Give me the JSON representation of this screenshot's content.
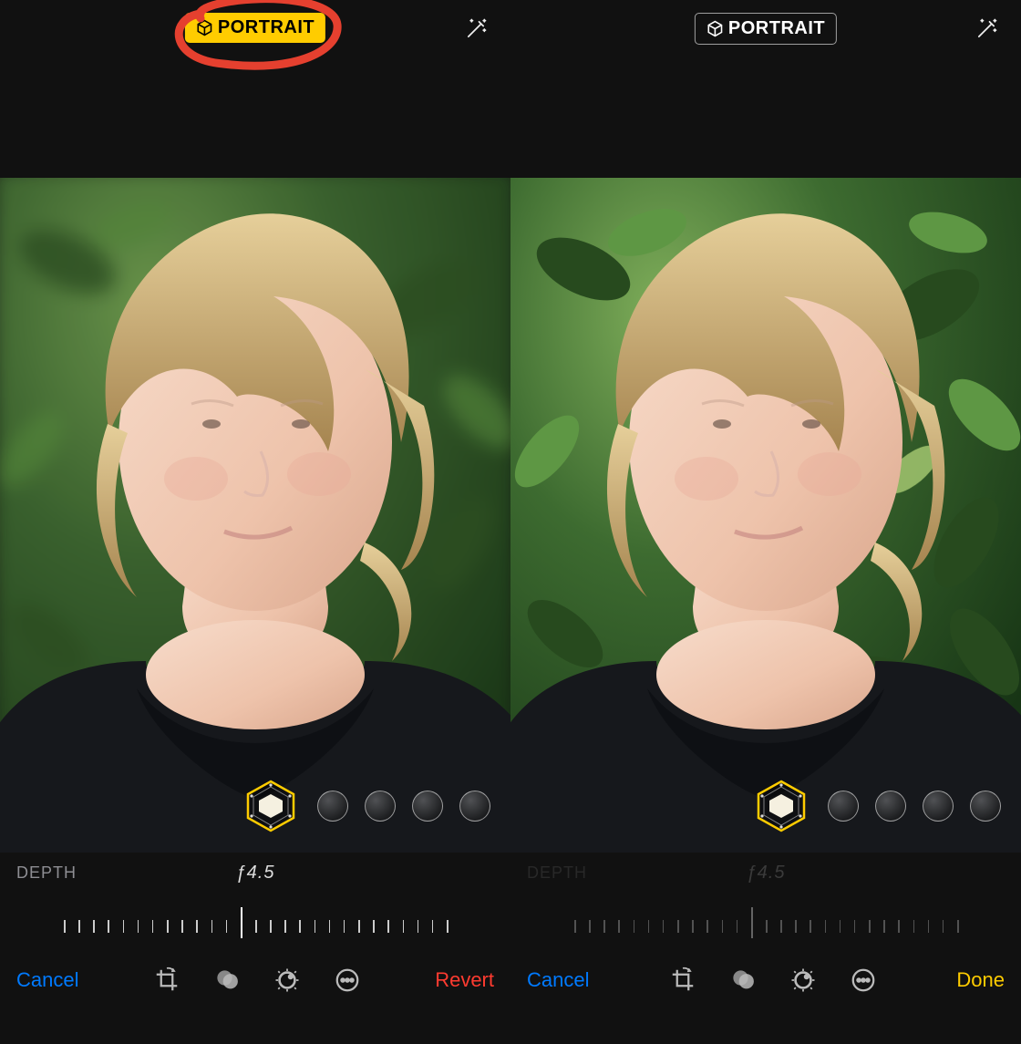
{
  "left": {
    "portrait_label": "PORTRAIT",
    "portrait_active": true,
    "annotated": true,
    "depth_label": "DEPTH",
    "f_value": "ƒ4.5",
    "toolbar": {
      "cancel": "Cancel",
      "confirm": "Revert",
      "confirm_style": "red"
    },
    "bg_blur": true
  },
  "right": {
    "portrait_label": "PORTRAIT",
    "portrait_active": false,
    "annotated": false,
    "depth_label": "DEPTH",
    "f_value": "ƒ4.5",
    "toolbar": {
      "cancel": "Cancel",
      "confirm": "Done",
      "confirm_style": "yellow"
    },
    "bg_blur": false
  },
  "ruler": {
    "ticks": 27,
    "indicator_index": 12
  },
  "lighting_options_count": 4,
  "icons": {
    "cube": "cube-icon",
    "wand": "magic-wand-icon",
    "crop": "crop-rotate-icon",
    "filters": "filters-icon",
    "adjust": "adjust-dial-icon",
    "more": "more-icon",
    "lighting_selected": "natural-light-icon"
  },
  "colors": {
    "accent_yellow": "#FFCC00",
    "link_blue": "#007AFF",
    "destructive_red": "#FF3B30",
    "annotation_red": "#E5402F"
  }
}
